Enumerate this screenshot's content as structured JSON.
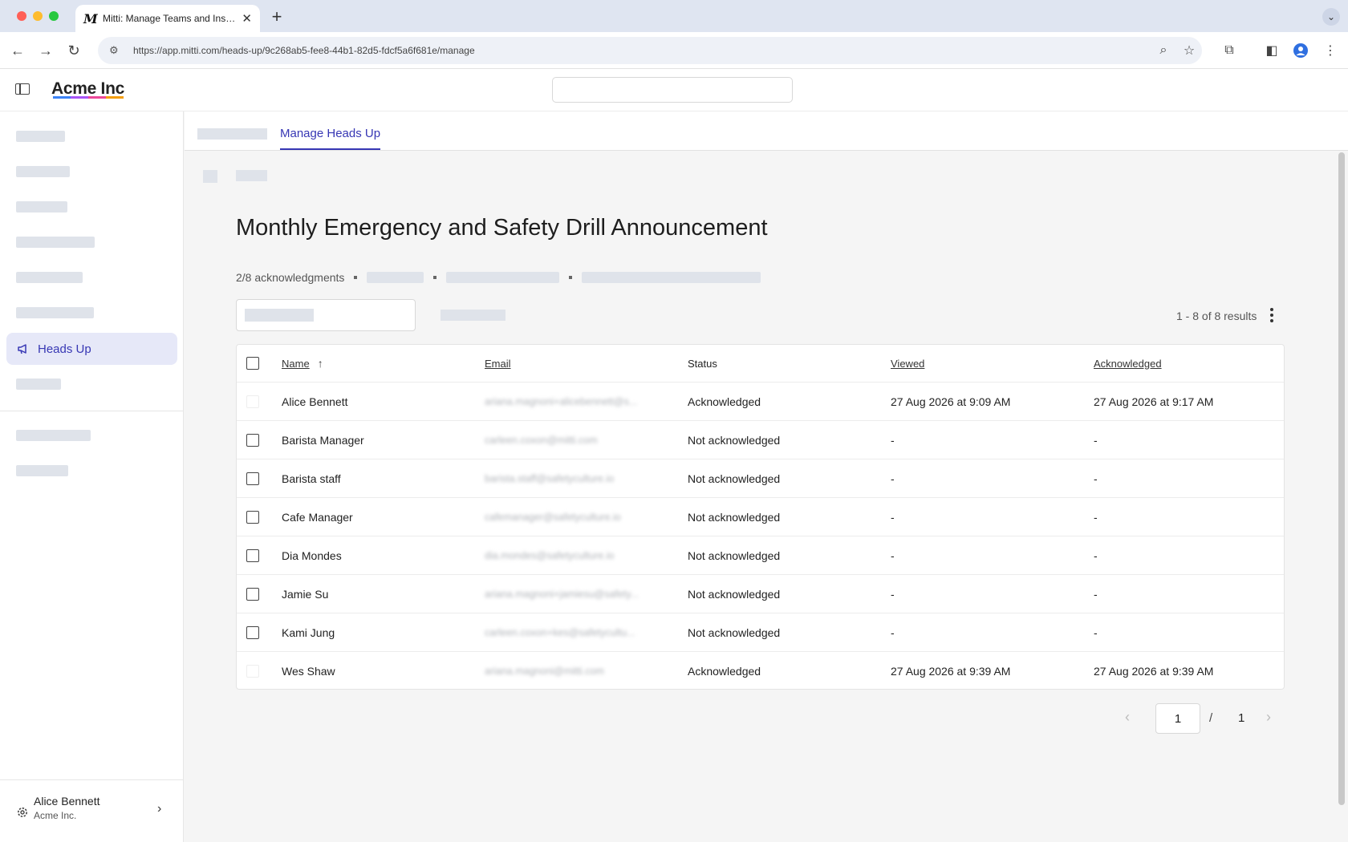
{
  "browser": {
    "tab_title": "Mitti: Manage Teams and Inspect...",
    "favicon_letter": "M",
    "url": "https://app.mitti.com/heads-up/9c268ab5-fee8-44b1-82d5-fdcf5a6f681e/manage"
  },
  "app": {
    "brand": "Acme Inc",
    "brand_colors": [
      "#3b82f6",
      "#a855f7",
      "#ec4899",
      "#f59e0b"
    ]
  },
  "sidebar": {
    "active_item": "Heads Up",
    "user_name": "Alice Bennett",
    "user_org": "Acme Inc."
  },
  "main": {
    "tab_active": "Manage Heads Up",
    "title": "Monthly Emergency and Safety Drill Announcement",
    "ack_summary": "2/8 acknowledgments",
    "results": "1 - 8 of 8 results"
  },
  "table": {
    "headers": {
      "name": "Name",
      "email": "Email",
      "status": "Status",
      "viewed": "Viewed",
      "acknowledged": "Acknowledged"
    },
    "rows": [
      {
        "name": "Alice Bennett",
        "email": "ariana.magnoni+alicebennett@s...",
        "status": "Acknowledged",
        "viewed": "27 Aug 2026 at 9:09 AM",
        "acknowledged": "27 Aug 2026 at 9:17 AM"
      },
      {
        "name": "Barista Manager",
        "email": "carleen.coxon@mitti.com",
        "status": "Not acknowledged",
        "viewed": "-",
        "acknowledged": "-"
      },
      {
        "name": "Barista staff",
        "email": "barista.staff@safetyculture.io",
        "status": "Not acknowledged",
        "viewed": "-",
        "acknowledged": "-"
      },
      {
        "name": "Cafe Manager",
        "email": "cafemanager@safetyculture.io",
        "status": "Not acknowledged",
        "viewed": "-",
        "acknowledged": "-"
      },
      {
        "name": "Dia Mondes",
        "email": "dia.mondes@safetyculture.io",
        "status": "Not acknowledged",
        "viewed": "-",
        "acknowledged": "-"
      },
      {
        "name": "Jamie Su",
        "email": "ariana.magnoni+jamiesu@safety...",
        "status": "Not acknowledged",
        "viewed": "-",
        "acknowledged": "-"
      },
      {
        "name": "Kami Jung",
        "email": "carleen.coxon+kes@safetycultu...",
        "status": "Not acknowledged",
        "viewed": "-",
        "acknowledged": "-"
      },
      {
        "name": "Wes Shaw",
        "email": "ariana.magnoni@mitti.com",
        "status": "Acknowledged",
        "viewed": "27 Aug 2026 at 9:39 AM",
        "acknowledged": "27 Aug 2026 at 9:39 AM"
      }
    ]
  },
  "pagination": {
    "current": "1",
    "separator": "/",
    "total": "1"
  },
  "colors": {
    "accent": "#3737b4",
    "active_nav_bg": "#e6e8f8",
    "skeleton": "#dfe3ea"
  },
  "icons": [
    "sidebar-toggle-icon",
    "megaphone-icon",
    "gear-icon",
    "chevron-right-icon",
    "sort-ascending-icon",
    "kebab-menu-icon",
    "chevron-left-icon"
  ]
}
